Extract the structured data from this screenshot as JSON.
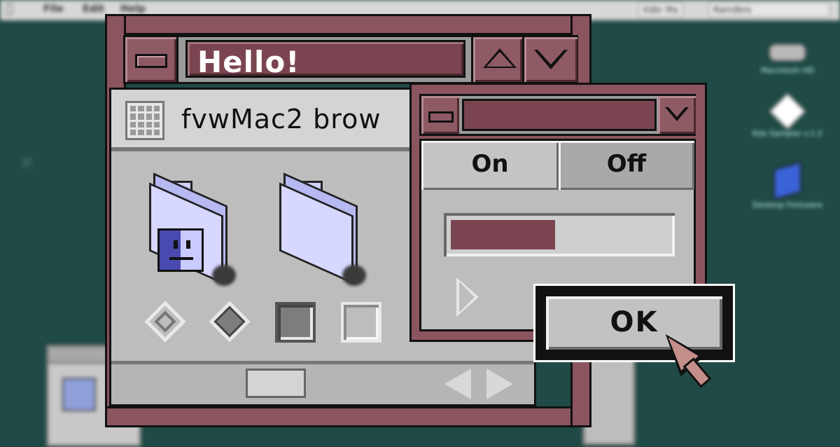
{
  "desktop": {
    "menu": [
      "File",
      "Edit",
      "Help"
    ],
    "right_items": [
      "Kdbr Ma",
      "Ramdbro"
    ],
    "icons": [
      {
        "label": "Macintosh HD"
      },
      {
        "label": "Kde Sampler v.1.2"
      },
      {
        "label": "Desktop Fomulare"
      }
    ]
  },
  "hello_window": {
    "title": "Hello!",
    "browser_title": "fvwMac2 brow",
    "controls": {
      "radio_unselected": false,
      "radio_selected": true,
      "checkbox_checked": true,
      "checkbox_unchecked": false
    },
    "colors": {
      "accent": "#7a4550",
      "panel": "#bdbdbd"
    }
  },
  "toggle_window": {
    "on_label": "On",
    "off_label": "Off",
    "selected": "On",
    "progress": 0.48
  },
  "dialog": {
    "ok_label": "OK"
  }
}
